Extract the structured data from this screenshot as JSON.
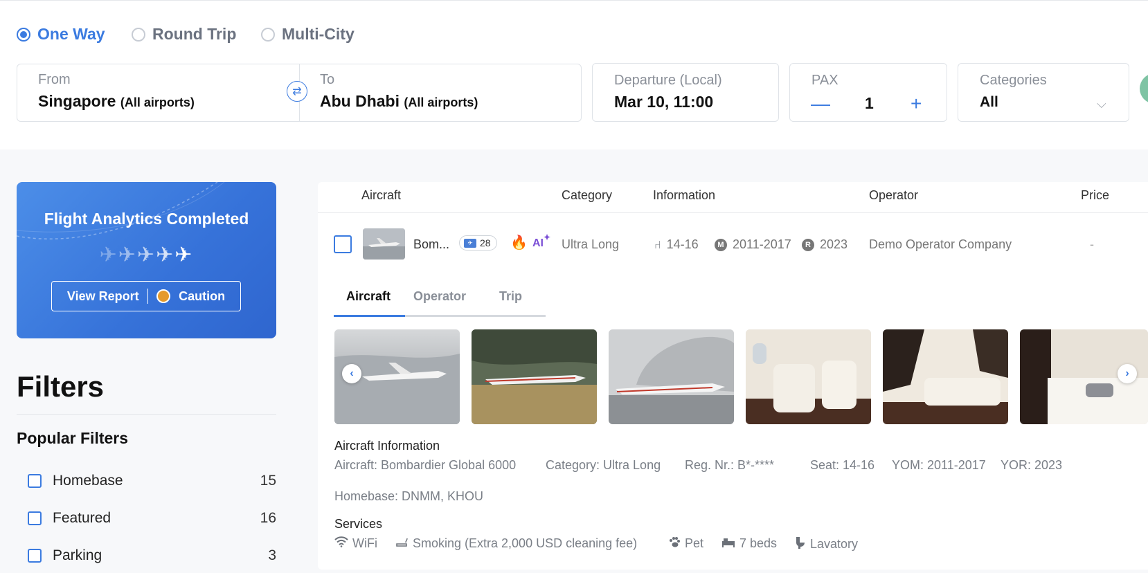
{
  "trip_types": [
    {
      "label": "One Way",
      "selected": true
    },
    {
      "label": "Round Trip",
      "selected": false
    },
    {
      "label": "Multi-City",
      "selected": false
    }
  ],
  "search": {
    "from_label": "From",
    "from_city": "Singapore",
    "from_suffix": "(All airports)",
    "to_label": "To",
    "to_city": "Abu Dhabi",
    "to_suffix": "(All airports)",
    "departure_label": "Departure (Local)",
    "departure_value": "Mar 10, 11:00",
    "pax_label": "PAX",
    "pax_value": "1",
    "pax_minus": "—",
    "pax_plus": "+",
    "categories_label": "Categories",
    "categories_value": "All"
  },
  "promo": {
    "title": "Flight Analytics Completed",
    "report_label": "View Report",
    "status_label": "Caution",
    "status_color": "#e59a2c"
  },
  "filters": {
    "title": "Filters",
    "popular_title": "Popular Filters",
    "items": [
      {
        "label": "Homebase",
        "count": "15"
      },
      {
        "label": "Featured",
        "count": "16"
      },
      {
        "label": "Parking",
        "count": "3"
      }
    ]
  },
  "table": {
    "headers": {
      "aircraft": "Aircraft",
      "category": "Category",
      "information": "Information",
      "operator": "Operator",
      "price": "Price"
    },
    "row": {
      "aircraft_short": "Bom...",
      "badge_count": "28",
      "ai_label": "AI",
      "category": "Ultra Long",
      "seats": "14-16",
      "yom_letter": "M",
      "yom": "2011-2017",
      "yor_letter": "R",
      "yor": "2023",
      "operator": "Demo Operator Company",
      "price": "-"
    }
  },
  "detail_tabs": [
    "Aircraft",
    "Operator",
    "Trip"
  ],
  "aircraft_info": {
    "title": "Aircraft Information",
    "aircraft": "Aircraft: Bombardier Global 6000",
    "category": "Category: Ultra Long",
    "reg": "Reg. Nr.: B*-****",
    "seat": "Seat: 14-16",
    "yom": "YOM: 2011-2017",
    "yor": "YOR: 2023",
    "homebase": "Homebase: DNMM, KHOU"
  },
  "services": {
    "title": "Services",
    "items": [
      "WiFi",
      "Smoking (Extra 2,000 USD cleaning fee)",
      "Pet",
      "7 beds",
      "Lavatory"
    ]
  },
  "colors": {
    "accent": "#3b7be0",
    "promo_bg": "#3672d9"
  }
}
